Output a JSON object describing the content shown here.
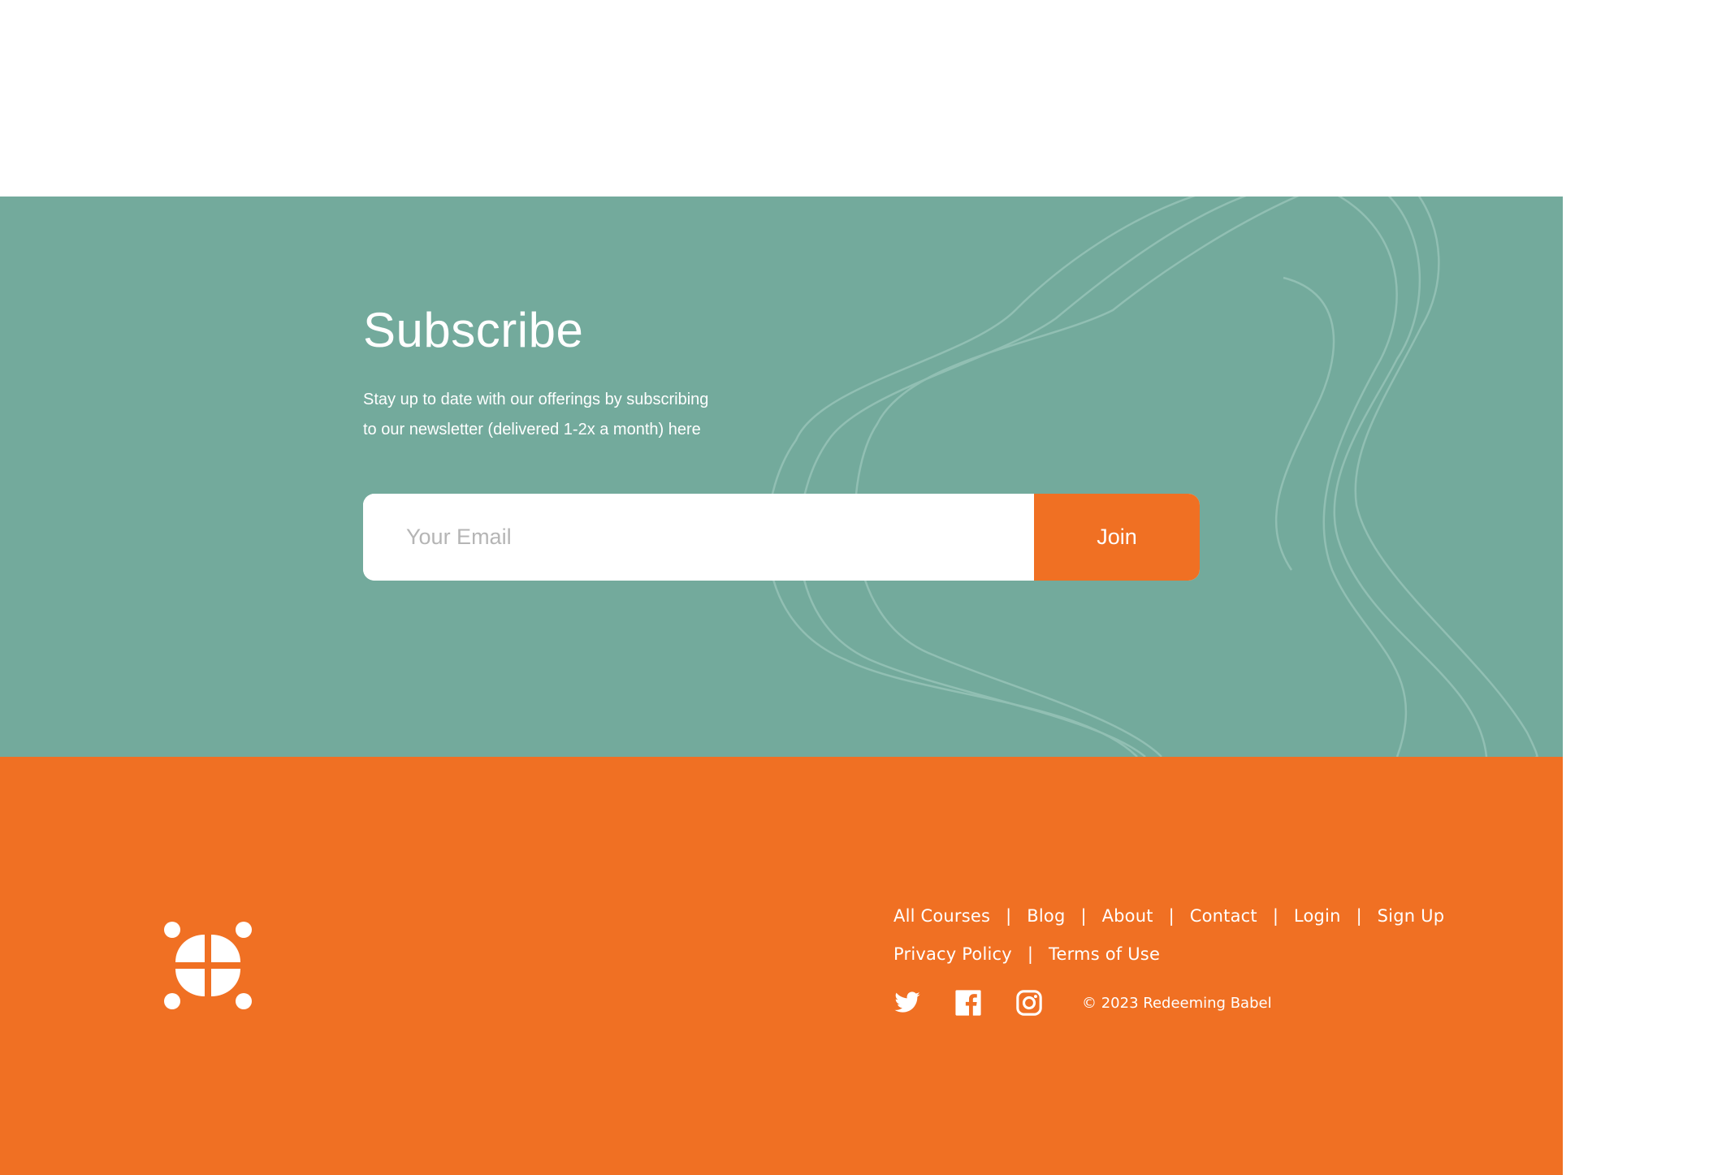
{
  "colors": {
    "teal": "#73aa9c",
    "orange": "#f07023",
    "white": "#ffffff",
    "placeholder": "#b5b5b5"
  },
  "subscribe": {
    "title": "Subscribe",
    "description_line1": "Stay up to date with our offerings by subscribing",
    "description_line2": "to our newsletter (delivered 1-2x a month) here",
    "email_placeholder": "Your Email",
    "join_label": "Join"
  },
  "footer": {
    "logo_icon": "redeeming-babel-logo-icon",
    "nav_row1": [
      {
        "label": "All Courses"
      },
      {
        "label": "Blog"
      },
      {
        "label": "About"
      },
      {
        "label": "Contact"
      },
      {
        "label": "Login"
      },
      {
        "label": "Sign Up"
      }
    ],
    "separator": "|",
    "nav_row2": [
      {
        "label": "Privacy Policy"
      },
      {
        "label": "Terms of Use"
      }
    ],
    "social_icons": [
      "twitter-icon",
      "facebook-icon",
      "instagram-icon"
    ],
    "copyright": "© 2023 Redeeming Babel"
  }
}
